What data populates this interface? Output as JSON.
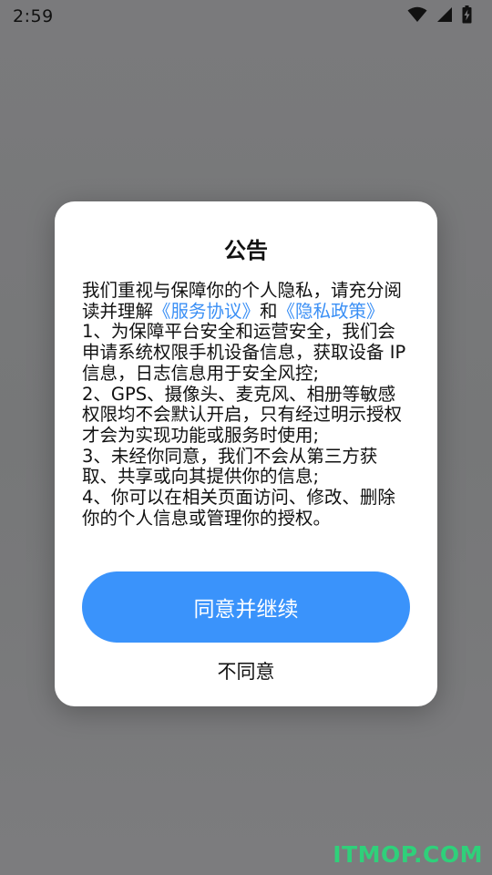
{
  "status_bar": {
    "time": "2:59",
    "icons": [
      "wifi-icon",
      "cellular-signal-icon",
      "battery-charging-icon"
    ]
  },
  "dialog": {
    "title": "公告",
    "intro_before": "我们重视与保障你的个人隐私，请充分阅读并理解",
    "service_link": "《服务协议》",
    "intro_and": "和",
    "privacy_link": "《隐私政策》",
    "items": [
      "1、为保障平台安全和运营安全，我们会申请系统权限手机设备信息，获取设备 IP 信息，日志信息用于安全风控;",
      "2、GPS、摄像头、麦克风、相册等敏感权限均不会默认开启，只有经过明示授权才会为实现功能或服务时使用;",
      "3、未经你同意，我们不会从第三方获取、共享或向其提供你的信息;",
      "4、你可以在相关页面访问、修改、删除你的个人信息或管理你的授权。"
    ],
    "agree_label": "同意并继续",
    "disagree_label": "不同意"
  },
  "watermark": "ITMOP.COM",
  "colors": {
    "accent": "#3a93fb",
    "link": "#3a8ff5",
    "watermark": "#2fd07a",
    "overlay": "#78787a"
  }
}
